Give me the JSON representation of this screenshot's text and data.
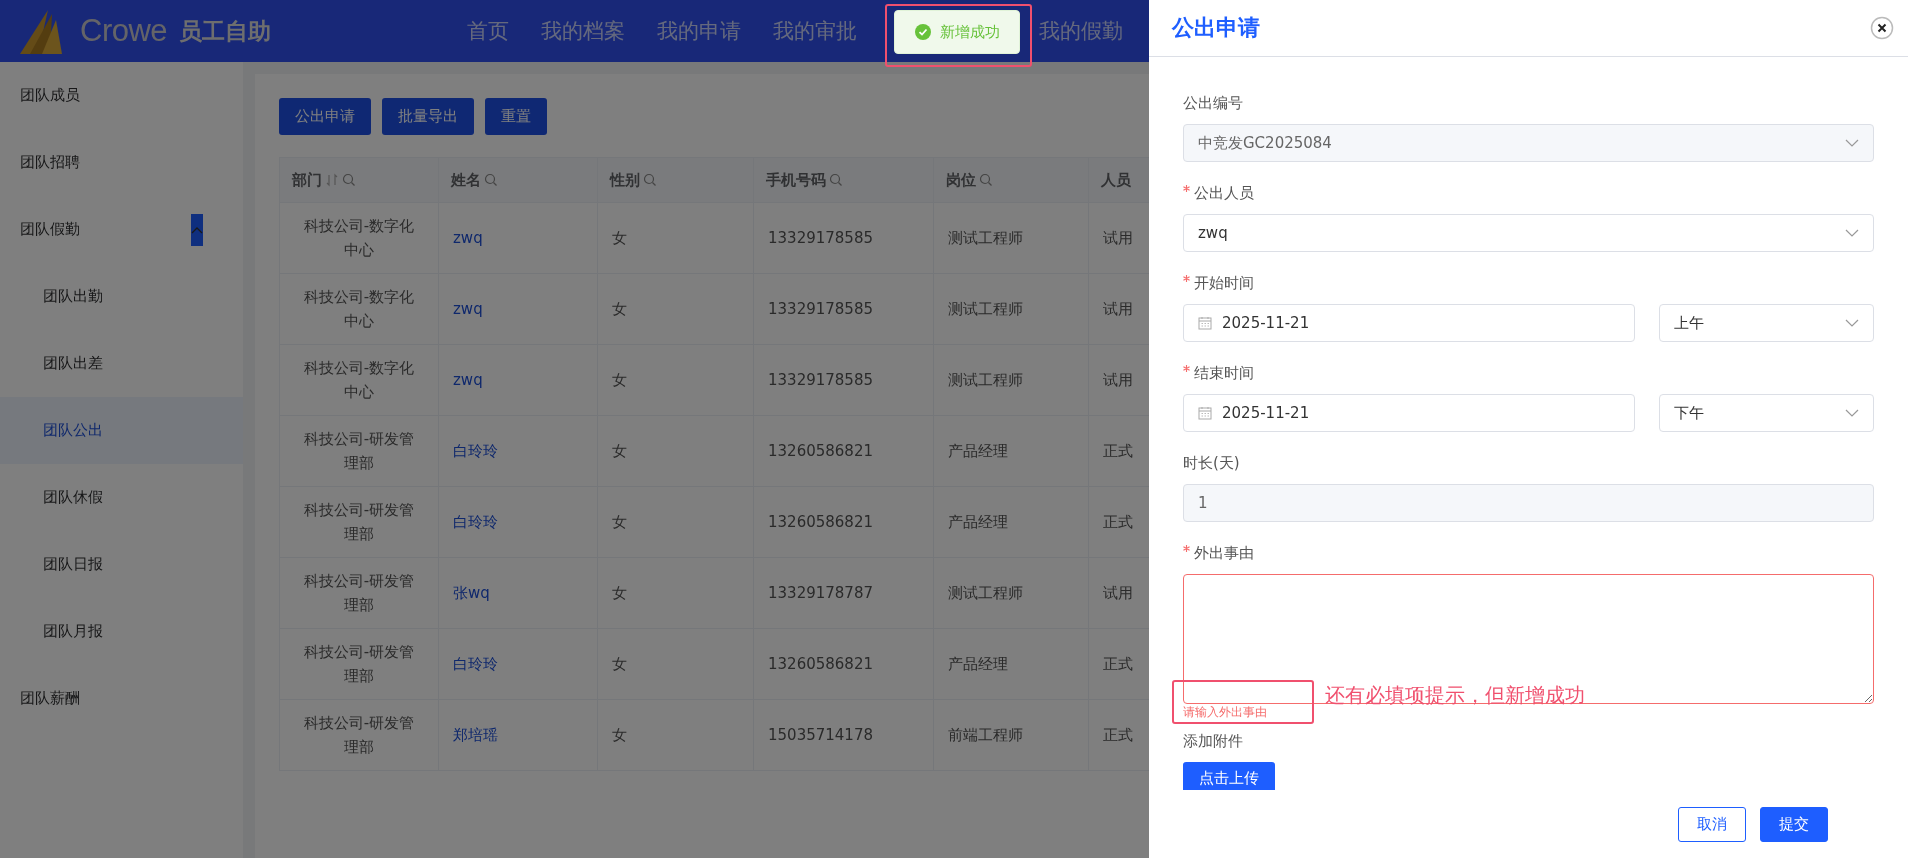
{
  "header": {
    "brand": "Crowe",
    "app_name": "员工自助",
    "nav": [
      "首页",
      "我的档案",
      "我的申请",
      "我的审批",
      "我的假勤"
    ]
  },
  "toast": {
    "kind": "success",
    "message": "新增成功"
  },
  "sidebar": {
    "items": [
      {
        "label": "团队成员",
        "selected": false
      },
      {
        "label": "团队招聘",
        "selected": false
      },
      {
        "label": "团队假勤",
        "selected": false,
        "expanded": true,
        "children": [
          {
            "label": "团队出勤",
            "selected": false
          },
          {
            "label": "团队出差",
            "selected": false
          },
          {
            "label": "团队公出",
            "selected": true
          },
          {
            "label": "团队休假",
            "selected": false
          },
          {
            "label": "团队日报",
            "selected": false
          },
          {
            "label": "团队月报",
            "selected": false
          }
        ]
      },
      {
        "label": "团队薪酬",
        "selected": false
      }
    ]
  },
  "toolbar": {
    "buttons": [
      "公出申请",
      "批量导出",
      "重置"
    ]
  },
  "table": {
    "columns": [
      {
        "label": "部门",
        "sortable": true,
        "filterable": true,
        "kind": "wrap"
      },
      {
        "label": "姓名",
        "sortable": false,
        "filterable": true,
        "kind": "link"
      },
      {
        "label": "性别",
        "sortable": false,
        "filterable": true,
        "kind": "text"
      },
      {
        "label": "手机号码",
        "sortable": false,
        "filterable": true,
        "kind": "text"
      },
      {
        "label": "岗位",
        "sortable": false,
        "filterable": true,
        "kind": "text"
      },
      {
        "label": "人员",
        "sortable": false,
        "filterable": false,
        "kind": "text"
      }
    ],
    "rows": [
      [
        "科技公司-数字化中心",
        "zwq",
        "女",
        "13329178585",
        "测试工程师",
        "试用"
      ],
      [
        "科技公司-数字化中心",
        "zwq",
        "女",
        "13329178585",
        "测试工程师",
        "试用"
      ],
      [
        "科技公司-数字化中心",
        "zwq",
        "女",
        "13329178585",
        "测试工程师",
        "试用"
      ],
      [
        "科技公司-研发管理部",
        "白玲玲",
        "女",
        "13260586821",
        "产品经理",
        "正式"
      ],
      [
        "科技公司-研发管理部",
        "白玲玲",
        "女",
        "13260586821",
        "产品经理",
        "正式"
      ],
      [
        "科技公司-研发管理部",
        "张wq",
        "女",
        "13329178787",
        "测试工程师",
        "试用"
      ],
      [
        "科技公司-研发管理部",
        "白玲玲",
        "女",
        "13260586821",
        "产品经理",
        "正式"
      ],
      [
        "科技公司-研发管理部",
        "郑培瑶",
        "女",
        "15035714178",
        "前端工程师",
        "正式"
      ]
    ]
  },
  "drawer": {
    "title": "公出申请",
    "fields": [
      {
        "kind": "select",
        "label": "公出编号",
        "required": false,
        "disabled": true,
        "value": "中竞发GC2025084"
      },
      {
        "kind": "select",
        "label": "公出人员",
        "required": true,
        "disabled": false,
        "value": "zwq"
      },
      {
        "kind": "date_period",
        "label": "开始时间",
        "required": true,
        "date": "2025-11-21",
        "period": "上午"
      },
      {
        "kind": "date_period",
        "label": "结束时间",
        "required": true,
        "date": "2025-11-21",
        "period": "下午"
      },
      {
        "kind": "text",
        "label": "时长(天)",
        "required": false,
        "disabled": true,
        "value": "1"
      },
      {
        "kind": "textarea",
        "label": "外出事由",
        "required": true,
        "error": "请输入外出事由"
      },
      {
        "kind": "upload",
        "label": "添加附件",
        "required": false,
        "button": "点击上传"
      }
    ],
    "footer": [
      {
        "label": "取消",
        "primary": false
      },
      {
        "label": "提交",
        "primary": true
      }
    ]
  },
  "annotations": [
    {
      "kind": "box"
    },
    {
      "kind": "box"
    },
    {
      "kind": "note",
      "text": "还有必填项提示，但新增成功"
    }
  ]
}
